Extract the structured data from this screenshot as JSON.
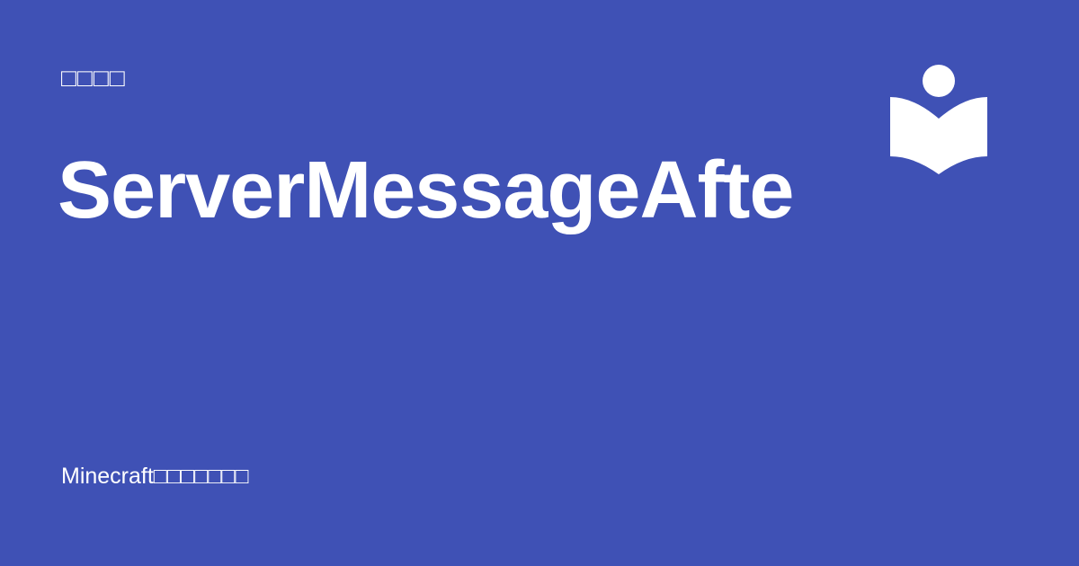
{
  "page": {
    "kicker": "□□□□",
    "title": "ServerMessageAfte",
    "footer_text": "Minecraft□□□□□□□",
    "logo_icon": "reader-book-icon"
  },
  "colors": {
    "background": "#3f51b5",
    "foreground": "#ffffff"
  }
}
